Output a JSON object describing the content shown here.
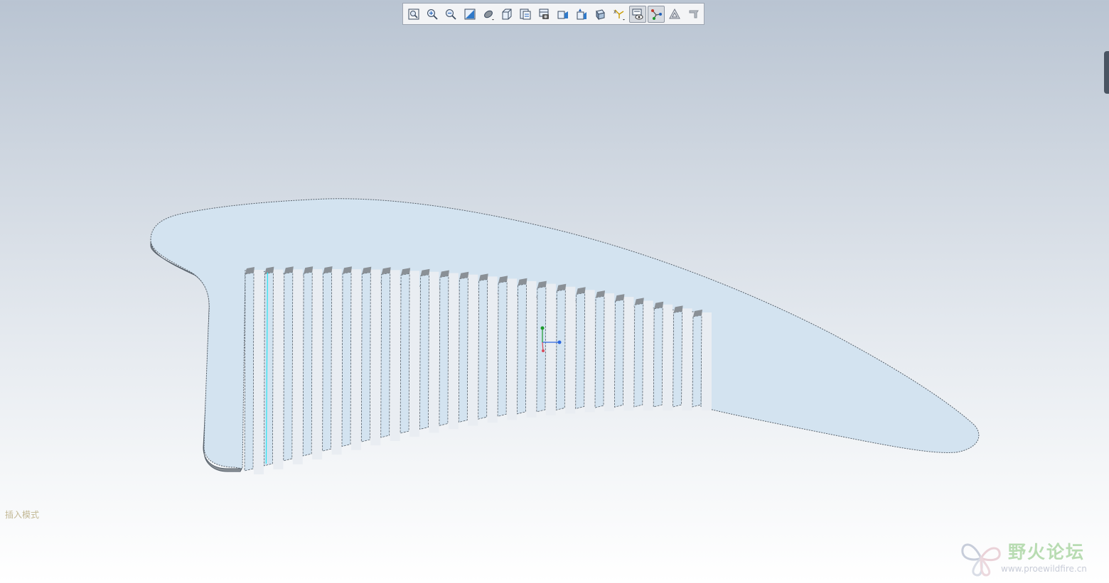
{
  "app": {
    "mode_status": "插入模式"
  },
  "toolbar": {
    "buttons": [
      {
        "name": "refit-icon"
      },
      {
        "name": "zoom-in-icon"
      },
      {
        "name": "zoom-out-icon"
      },
      {
        "name": "repaint-icon"
      },
      {
        "name": "display-style-icon"
      },
      {
        "name": "saved-views-icon"
      },
      {
        "name": "view-manager-icon"
      },
      {
        "name": "section-icon"
      },
      {
        "name": "perspective-icon"
      },
      {
        "name": "spin-center-icon"
      },
      {
        "name": "annotation-display-icon"
      },
      {
        "name": "datum-display-icon"
      },
      {
        "name": "plane-display-icon",
        "active": true
      },
      {
        "name": "axis-display-icon",
        "active": true
      },
      {
        "name": "point-display-icon"
      },
      {
        "name": "csys-display-icon"
      }
    ]
  },
  "model": {
    "name": "comb",
    "tooth_count": 24,
    "colors": {
      "surface": "#d3e3f0",
      "side": "#8a9096",
      "edge": "#56606a",
      "highlight_edge": "#29e3f0"
    }
  },
  "csys": {
    "colors": {
      "x": "#2b66e0",
      "y": "#1a9a2a",
      "z": "#d84a5a"
    }
  },
  "watermark": {
    "title": "野火论坛",
    "url": "www.proewildfire.cn"
  }
}
